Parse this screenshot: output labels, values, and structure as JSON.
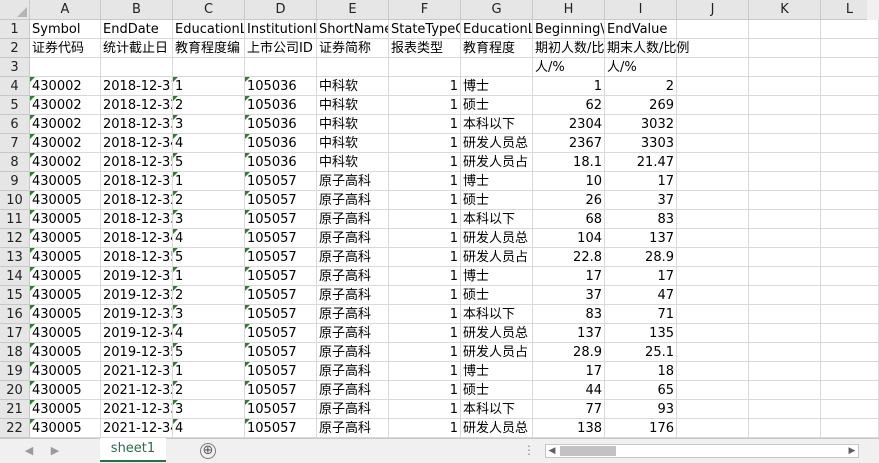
{
  "columns": [
    "A",
    "B",
    "C",
    "D",
    "E",
    "F",
    "G",
    "H",
    "I",
    "J",
    "K",
    "L"
  ],
  "rows": [
    {
      "n": "1",
      "cells": [
        "Symbol",
        "EndDate",
        "EducationL",
        "InstitutionI",
        "ShortName",
        "StateTypeC",
        "EducationL",
        "Beginning\\",
        "EndValue",
        "",
        "",
        ""
      ]
    },
    {
      "n": "2",
      "cells": [
        "证券代码",
        "统计截止日",
        "教育程度编",
        "上市公司ID",
        "证券简称",
        "报表类型",
        "教育程度",
        "期初人数/比",
        "期末人数/比例",
        "",
        "",
        ""
      ]
    },
    {
      "n": "3",
      "cells": [
        "",
        "",
        "",
        "",
        "",
        "",
        "",
        "人/%",
        "人/%",
        "",
        "",
        ""
      ]
    },
    {
      "n": "4",
      "cells": [
        "430002",
        "2018-12-31",
        "1",
        "105036",
        "中科软",
        "1",
        "博士",
        "1",
        "2",
        "",
        "",
        ""
      ]
    },
    {
      "n": "5",
      "cells": [
        "430002",
        "2018-12-32",
        "2",
        "105036",
        "中科软",
        "1",
        "硕士",
        "62",
        "269",
        "",
        "",
        ""
      ]
    },
    {
      "n": "6",
      "cells": [
        "430002",
        "2018-12-33",
        "3",
        "105036",
        "中科软",
        "1",
        "本科以下",
        "2304",
        "3032",
        "",
        "",
        ""
      ]
    },
    {
      "n": "7",
      "cells": [
        "430002",
        "2018-12-34",
        "4",
        "105036",
        "中科软",
        "1",
        "研发人员总",
        "2367",
        "3303",
        "",
        "",
        ""
      ]
    },
    {
      "n": "8",
      "cells": [
        "430002",
        "2018-12-35",
        "5",
        "105036",
        "中科软",
        "1",
        "研发人员占",
        "18.1",
        "21.47",
        "",
        "",
        ""
      ]
    },
    {
      "n": "9",
      "cells": [
        "430005",
        "2018-12-31",
        "1",
        "105057",
        "原子高科",
        "1",
        "博士",
        "10",
        "17",
        "",
        "",
        ""
      ]
    },
    {
      "n": "10",
      "cells": [
        "430005",
        "2018-12-32",
        "2",
        "105057",
        "原子高科",
        "1",
        "硕士",
        "26",
        "37",
        "",
        "",
        ""
      ]
    },
    {
      "n": "11",
      "cells": [
        "430005",
        "2018-12-33",
        "3",
        "105057",
        "原子高科",
        "1",
        "本科以下",
        "68",
        "83",
        "",
        "",
        ""
      ]
    },
    {
      "n": "12",
      "cells": [
        "430005",
        "2018-12-34",
        "4",
        "105057",
        "原子高科",
        "1",
        "研发人员总",
        "104",
        "137",
        "",
        "",
        ""
      ]
    },
    {
      "n": "13",
      "cells": [
        "430005",
        "2018-12-35",
        "5",
        "105057",
        "原子高科",
        "1",
        "研发人员占",
        "22.8",
        "28.9",
        "",
        "",
        ""
      ]
    },
    {
      "n": "14",
      "cells": [
        "430005",
        "2019-12-31",
        "1",
        "105057",
        "原子高科",
        "1",
        "博士",
        "17",
        "17",
        "",
        "",
        ""
      ]
    },
    {
      "n": "15",
      "cells": [
        "430005",
        "2019-12-32",
        "2",
        "105057",
        "原子高科",
        "1",
        "硕士",
        "37",
        "47",
        "",
        "",
        ""
      ]
    },
    {
      "n": "16",
      "cells": [
        "430005",
        "2019-12-33",
        "3",
        "105057",
        "原子高科",
        "1",
        "本科以下",
        "83",
        "71",
        "",
        "",
        ""
      ]
    },
    {
      "n": "17",
      "cells": [
        "430005",
        "2019-12-34",
        "4",
        "105057",
        "原子高科",
        "1",
        "研发人员总",
        "137",
        "135",
        "",
        "",
        ""
      ]
    },
    {
      "n": "18",
      "cells": [
        "430005",
        "2019-12-35",
        "5",
        "105057",
        "原子高科",
        "1",
        "研发人员占",
        "28.9",
        "25.1",
        "",
        "",
        ""
      ]
    },
    {
      "n": "19",
      "cells": [
        "430005",
        "2021-12-31",
        "1",
        "105057",
        "原子高科",
        "1",
        "博士",
        "17",
        "18",
        "",
        "",
        ""
      ]
    },
    {
      "n": "20",
      "cells": [
        "430005",
        "2021-12-32",
        "2",
        "105057",
        "原子高科",
        "1",
        "硕士",
        "44",
        "65",
        "",
        "",
        ""
      ]
    },
    {
      "n": "21",
      "cells": [
        "430005",
        "2021-12-33",
        "3",
        "105057",
        "原子高科",
        "1",
        "本科以下",
        "77",
        "93",
        "",
        "",
        ""
      ]
    },
    {
      "n": "22",
      "cells": [
        "430005",
        "2021-12-34",
        "4",
        "105057",
        "原子高科",
        "1",
        "研发人员总",
        "138",
        "176",
        "",
        "",
        ""
      ]
    }
  ],
  "sheet_tab": "sheet1",
  "add_sheet_label": "⊕",
  "nav_prev": "◀",
  "nav_next": "▶",
  "dots_label": "⋮",
  "scroll_left": "◀",
  "scroll_right": "▶",
  "accent": "#217346"
}
